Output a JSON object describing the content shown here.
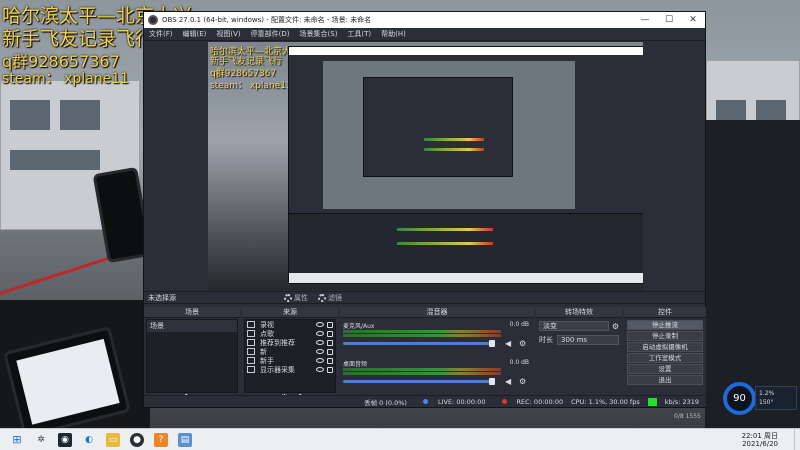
{
  "overlay": {
    "line1": "哈尔滨太平—北京大兴",
    "line2": "新手飞友记录飞行",
    "line3": "q群928657367",
    "line4": "steam： xplane11"
  },
  "window": {
    "title": "OBS 27.0.1 (64-bit, windows) - 配置文件: 未命名 - 场景: 未命名",
    "minimize": "—",
    "maximize": "☐",
    "close": "✕"
  },
  "menu": [
    "文件(F)",
    "编辑(E)",
    "视图(V)",
    "停靠部件(D)",
    "场景集合(S)",
    "工具(T)",
    "帮助(H)"
  ],
  "scene_bar": {
    "no_source": "未选择源",
    "properties": "属性",
    "filters": "滤镜"
  },
  "scenes": {
    "title": "场景",
    "items": [
      "场景"
    ]
  },
  "sources": {
    "title": "来源",
    "items": [
      "录视",
      "点歌",
      "推荐到推荐",
      "新",
      "新手",
      "显示器采集"
    ]
  },
  "mixer": {
    "title": "混音器",
    "channels": [
      {
        "name": "麦克风/Aux",
        "db": "0.0 dB",
        "level": 0.0
      },
      {
        "name": "桌面音频",
        "db": "0.0 dB",
        "level": 0.0
      }
    ]
  },
  "transitions": {
    "title": "转场特效",
    "type": "淡变",
    "duration_label": "时长",
    "duration": "300 ms"
  },
  "controls": {
    "title": "控件",
    "buttons": [
      "停止推流",
      "停止录制",
      "启动虚拟摄像机",
      "工作室模式",
      "设置",
      "退出"
    ]
  },
  "status": {
    "dropped": "丢帧 0 (0.0%)",
    "live": "LIVE: 00:00:00",
    "rec": "REC: 00:00:00",
    "cpu": "CPU: 1.1%, 30.00 fps",
    "kbps": "kb/s: 2319"
  },
  "hud": {
    "gauge": "90",
    "line1": "1.2%",
    "line2": "150°",
    "fps_small": "0/8 1555"
  },
  "taskbar": {
    "time": "22:01 周日",
    "date": "2021/6/20"
  },
  "colors": {
    "obs_bg": "#2b2e38",
    "status_ok": "#20e22a",
    "overlay_text": "#f2d24b",
    "accent_blue": "#1f6ad9"
  }
}
